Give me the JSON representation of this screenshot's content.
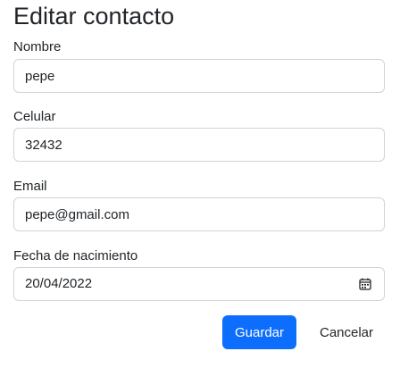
{
  "page": {
    "title": "Editar contacto"
  },
  "form": {
    "nombre": {
      "label": "Nombre",
      "value": "pepe"
    },
    "celular": {
      "label": "Celular",
      "value": "32432"
    },
    "email": {
      "label": "Email",
      "value": "pepe@gmail.com"
    },
    "fecha": {
      "label": "Fecha de nacimiento",
      "value": "20/04/2022",
      "icon": "calendar-icon"
    }
  },
  "actions": {
    "save_label": "Guardar",
    "cancel_label": "Cancelar"
  },
  "colors": {
    "primary": "#0d6efd",
    "text": "#212529",
    "border": "#ced4da"
  }
}
